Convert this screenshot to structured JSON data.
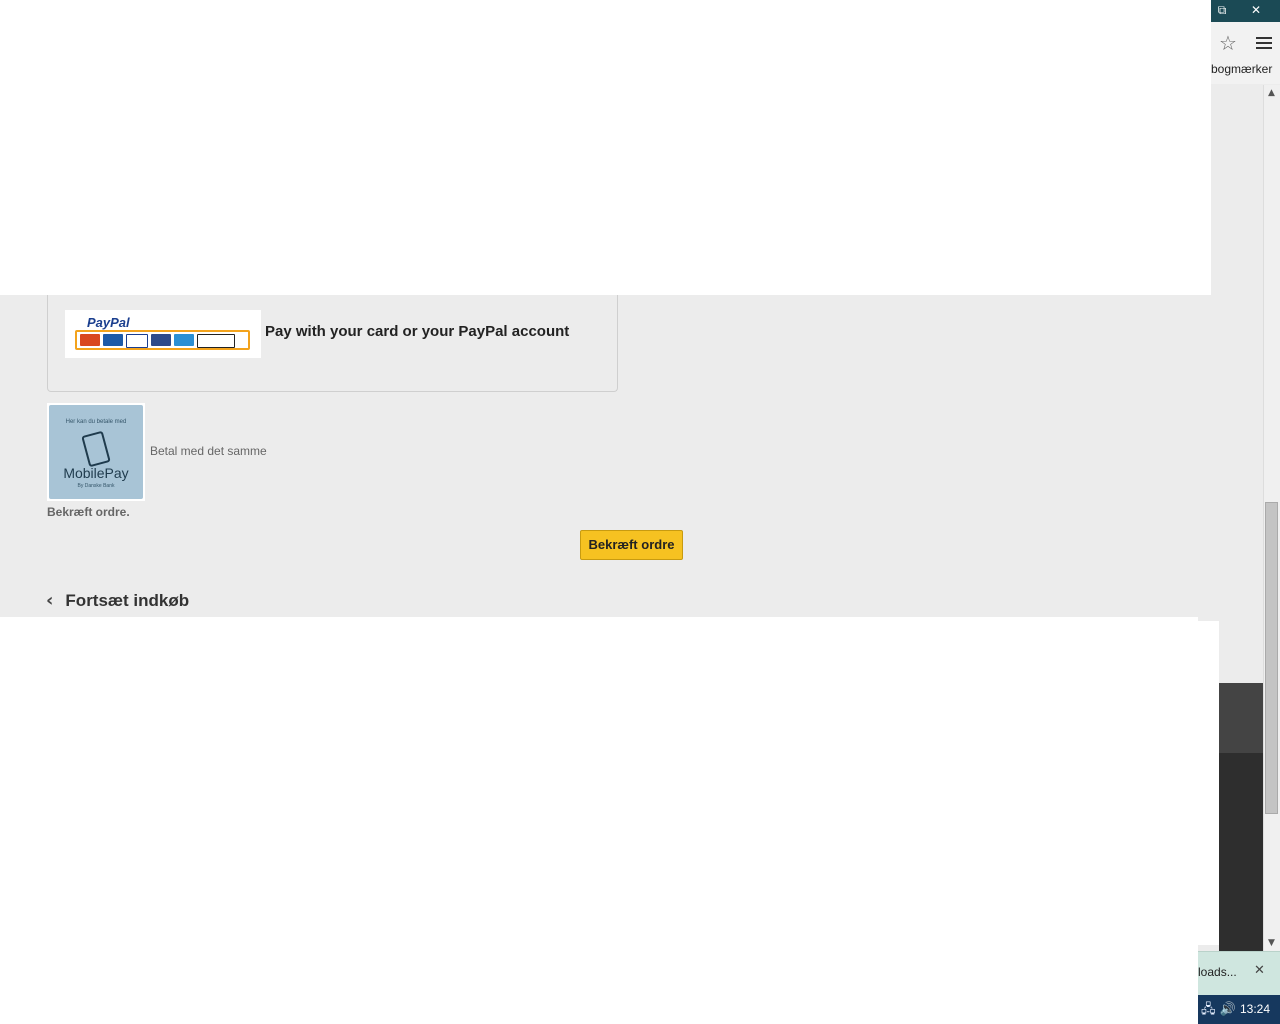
{
  "browser": {
    "restore_glyph": "⧉",
    "close_glyph": "✕",
    "star_glyph": "☆",
    "bookmarks_label": "bogmærker",
    "scroll_up_glyph": "▲",
    "scroll_down_glyph": "▼"
  },
  "payment": {
    "paypal_logo_text": "PayPal",
    "paypal_text": "Pay with your card or your PayPal account",
    "mobilepay_logo_top": "Her kan du betale med",
    "mobilepay_logo_brand": "MobilePay",
    "mobilepay_logo_sub": "By Danske Bank",
    "mobilepay_text": "Betal med det samme",
    "confirm_label": "Bekræft ordre.",
    "confirm_button": "Bekræft ordre"
  },
  "navigation": {
    "continue_label": "Fortsæt indkøb",
    "chevron_glyph": "‹"
  },
  "downloads": {
    "label": "loads...",
    "close_glyph": "✕"
  },
  "taskbar": {
    "tray_glyphs": "🖧 🔊",
    "clock": "13:24"
  },
  "colors": {
    "confirm_button": "#f6c221",
    "titlebar": "#1b4a55",
    "taskbar": "#16385e"
  }
}
